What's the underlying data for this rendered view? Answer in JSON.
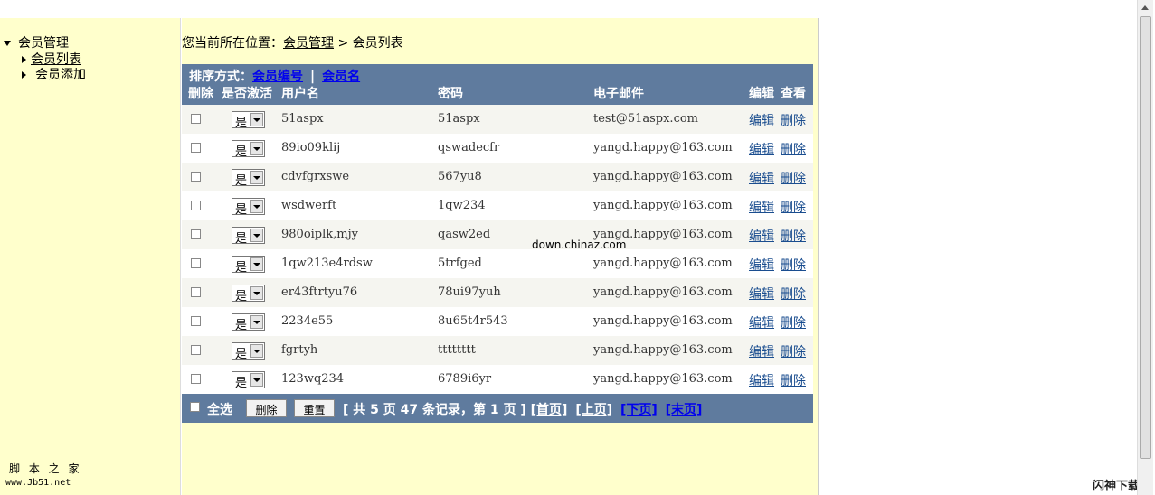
{
  "sidebar": {
    "root": "会员管理",
    "items": [
      {
        "label": "会员列表",
        "active": true
      },
      {
        "label": "会员添加",
        "active": false
      }
    ],
    "logo_line1": "脚 本 之 家",
    "logo_line2": "www.Jb51.net"
  },
  "breadcrumb": {
    "prefix": "您当前所在位置：",
    "link": "会员管理",
    "sep": " > ",
    "current": "会员列表"
  },
  "grid": {
    "sort_label": "排序方式：",
    "sort_by_id": "会员编号",
    "sort_sep": "|",
    "sort_by_name": "会员名",
    "headers": {
      "delete": "删除",
      "active": "是否激活",
      "username": "用户名",
      "password": "密码",
      "email": "电子邮件",
      "edit": "编辑",
      "view": "查看"
    },
    "rows": [
      {
        "active": "是",
        "username": "51aspx",
        "password": "51aspx",
        "email": "test@51aspx.com",
        "edit": "编辑",
        "del": "删除"
      },
      {
        "active": "是",
        "username": "89io09klij",
        "password": "qswadecfr",
        "email": "yangd.happy@163.com",
        "edit": "编辑",
        "del": "删除"
      },
      {
        "active": "是",
        "username": "cdvfgrxswe",
        "password": "567yu8",
        "email": "yangd.happy@163.com",
        "edit": "编辑",
        "del": "删除"
      },
      {
        "active": "是",
        "username": "wsdwerft",
        "password": "1qw234",
        "email": "yangd.happy@163.com",
        "edit": "编辑",
        "del": "删除"
      },
      {
        "active": "是",
        "username": "980oiplk,mjy",
        "password": "qasw2ed",
        "email": "yangd.happy@163.com",
        "edit": "编辑",
        "del": "删除"
      },
      {
        "active": "是",
        "username": "1qw213e4rdsw",
        "password": "5trfged",
        "email": "yangd.happy@163.com",
        "edit": "编辑",
        "del": "删除"
      },
      {
        "active": "是",
        "username": "er43ftrtyu76",
        "password": "78ui97yuh",
        "email": "yangd.happy@163.com",
        "edit": "编辑",
        "del": "删除"
      },
      {
        "active": "是",
        "username": "2234e55",
        "password": "8u65t4r543",
        "email": "yangd.happy@163.com",
        "edit": "编辑",
        "del": "删除"
      },
      {
        "active": "是",
        "username": "fgrtyh",
        "password": "tttttttt",
        "email": "yangd.happy@163.com",
        "edit": "编辑",
        "del": "删除"
      },
      {
        "active": "是",
        "username": "123wq234",
        "password": "6789i6yr",
        "email": "yangd.happy@163.com",
        "edit": "编辑",
        "del": "删除"
      }
    ],
    "footer": {
      "select_all": "全选",
      "delete_btn": "删除",
      "reset_btn": "重置",
      "summary": "[ 共 5 页 47 条记录，第 1 页 ]",
      "first": "[首页]",
      "prev": "[上页]",
      "next": "[下页]",
      "last": "[末页]"
    }
  },
  "watermark": "down.chinaz.com",
  "brand": "闪神下载网",
  "colors": {
    "header_bg": "#5f7b9e",
    "panel_bg": "#ffffcc",
    "link": "#0000ee"
  }
}
